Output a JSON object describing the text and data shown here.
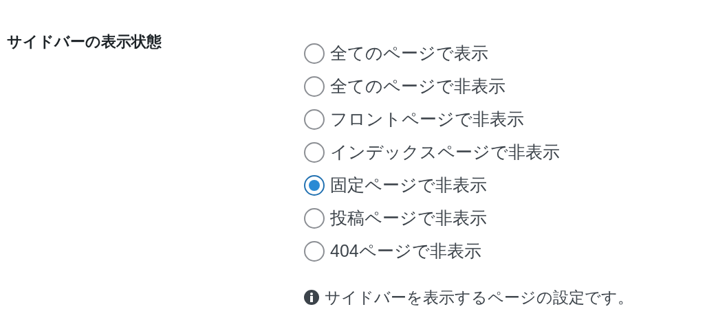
{
  "setting": {
    "label": "サイドバーの表示状態",
    "options": [
      {
        "label": "全てのページで表示",
        "selected": false
      },
      {
        "label": "全てのページで非表示",
        "selected": false
      },
      {
        "label": "フロントページで非表示",
        "selected": false
      },
      {
        "label": "インデックスページで非表示",
        "selected": false
      },
      {
        "label": "固定ページで非表示",
        "selected": true
      },
      {
        "label": "投稿ページで非表示",
        "selected": false
      },
      {
        "label": "404ページで非表示",
        "selected": false
      }
    ],
    "description": "サイドバーを表示するページの設定です。"
  }
}
